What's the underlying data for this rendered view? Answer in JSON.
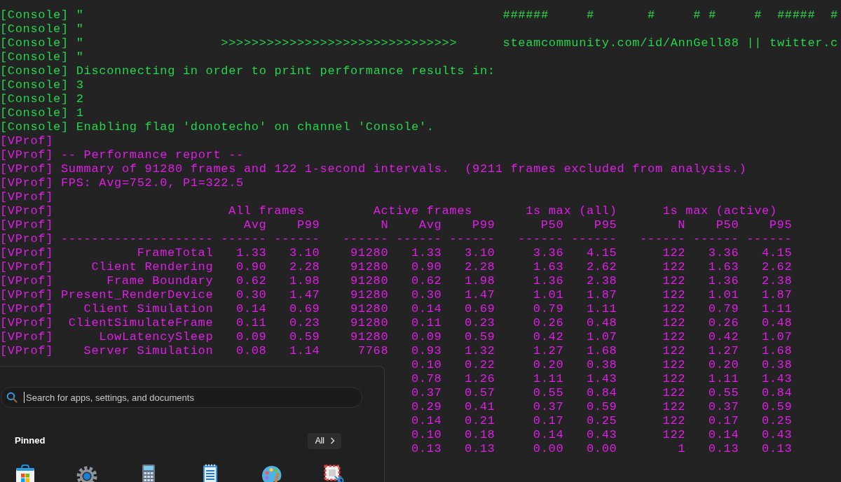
{
  "console": {
    "lines": [
      {
        "color": "#22d84a",
        "text": "[Console] \"                                                       ######     #       #     # #     #  #####  #"
      },
      {
        "color": "#22d84a",
        "text": "[Console] \""
      },
      {
        "color": "#22d84a",
        "text": "[Console] \"                  >>>>>>>>>>>>>>>>>>>>>>>>>>>>>>>      steamcommunity.com/id/AnnGell88 || twitter.c"
      },
      {
        "color": "#22d84a",
        "text": "[Console] \""
      },
      {
        "color": "#22d84a",
        "text": "[Console] Disconnecting in order to print performance results in:"
      },
      {
        "color": "#22d84a",
        "text": "[Console] 3"
      },
      {
        "color": "#22d84a",
        "text": "[Console] 2"
      },
      {
        "color": "#22d84a",
        "text": "[Console] 1"
      },
      {
        "color": "#22d84a",
        "text": "[Console] Enabling flag 'donotecho' on channel 'Console'."
      },
      {
        "color": "#e01ee8",
        "text": "[VProf]"
      },
      {
        "color": "#e01ee8",
        "text": "[VProf] -- Performance report --"
      },
      {
        "color": "#e01ee8",
        "text": "[VProf] Summary of 91280 frames and 122 1-second intervals.  (9211 frames excluded from analysis.)"
      },
      {
        "color": "#e01ee8",
        "text": "[VProf] FPS: Avg=752.0, P1=322.5"
      },
      {
        "color": "#e01ee8",
        "text": "[VProf]"
      }
    ]
  },
  "report_table": {
    "color": "#e01ee8",
    "groups": {
      "tag": "[VProf]",
      "labels": [
        "All frames",
        "Active frames",
        "1s max (all)",
        "1s max (active)"
      ]
    },
    "header": {
      "tag": "[VProf]",
      "cells": [
        "Avg",
        "P99",
        "N",
        "Avg",
        "P99",
        "P50",
        "P95",
        "N",
        "P50",
        "P95"
      ]
    },
    "rule": {
      "tag": "[VProf]",
      "cells": [
        "--------------------",
        "------",
        "------",
        "------",
        "------",
        "------",
        "------",
        "------",
        "------",
        "------",
        "------"
      ]
    },
    "rows": [
      {
        "tag": "[VProf]",
        "cells": [
          "FrameTotal",
          "1.33",
          "3.10",
          "91280",
          "1.33",
          "3.10",
          "3.36",
          "4.15",
          "122",
          "3.36",
          "4.15"
        ]
      },
      {
        "tag": "[VProf]",
        "cells": [
          "Client Rendering",
          "0.90",
          "2.28",
          "91280",
          "0.90",
          "2.28",
          "1.63",
          "2.62",
          "122",
          "1.63",
          "2.62"
        ]
      },
      {
        "tag": "[VProf]",
        "cells": [
          "Frame Boundary",
          "0.62",
          "1.98",
          "91280",
          "0.62",
          "1.98",
          "1.36",
          "2.38",
          "122",
          "1.36",
          "2.38"
        ]
      },
      {
        "tag": "[VProf]",
        "cells": [
          "Present_RenderDevice",
          "0.30",
          "1.47",
          "91280",
          "0.30",
          "1.47",
          "1.01",
          "1.87",
          "122",
          "1.01",
          "1.87"
        ]
      },
      {
        "tag": "[VProf]",
        "cells": [
          "Client Simulation",
          "0.14",
          "0.69",
          "91280",
          "0.14",
          "0.69",
          "0.79",
          "1.11",
          "122",
          "0.79",
          "1.11"
        ]
      },
      {
        "tag": "[VProf]",
        "cells": [
          "ClientSimulateFrame",
          "0.11",
          "0.23",
          "91280",
          "0.11",
          "0.23",
          "0.26",
          "0.48",
          "122",
          "0.26",
          "0.48"
        ]
      },
      {
        "tag": "[VProf]",
        "cells": [
          "LowLatencySleep",
          "0.09",
          "0.59",
          "91280",
          "0.09",
          "0.59",
          "0.42",
          "1.07",
          "122",
          "0.42",
          "1.07"
        ]
      },
      {
        "tag": "[VProf]",
        "cells": [
          "Server Simulation",
          "0.08",
          "1.14",
          "7768",
          "0.93",
          "1.32",
          "1.27",
          "1.68",
          "122",
          "1.27",
          "1.68"
        ]
      },
      {
        "cells": [
          "0.10",
          "0.22",
          "0.20",
          "0.38",
          "122",
          "0.20",
          "0.38"
        ]
      },
      {
        "cells": [
          "0.78",
          "1.26",
          "1.11",
          "1.43",
          "122",
          "1.11",
          "1.43"
        ]
      },
      {
        "cells": [
          "0.37",
          "0.57",
          "0.55",
          "0.84",
          "122",
          "0.55",
          "0.84"
        ]
      },
      {
        "cells": [
          "0.29",
          "0.41",
          "0.37",
          "0.59",
          "122",
          "0.37",
          "0.59"
        ]
      },
      {
        "cells": [
          "0.14",
          "0.21",
          "0.17",
          "0.25",
          "122",
          "0.17",
          "0.25"
        ]
      },
      {
        "cells": [
          "0.10",
          "0.18",
          "0.14",
          "0.43",
          "122",
          "0.14",
          "0.43"
        ]
      },
      {
        "cells": [
          "0.13",
          "0.13",
          "0.00",
          "0.00",
          "1",
          "0.13",
          "0.13"
        ]
      }
    ]
  },
  "start_menu": {
    "search": {
      "placeholder": "Search for apps, settings, and documents"
    },
    "pinned_label": "Pinned",
    "all_button": {
      "label": "All"
    },
    "pinned_apps": [
      {
        "kind": "store"
      },
      {
        "kind": "settings"
      },
      {
        "kind": "calculator"
      },
      {
        "kind": "notepad"
      },
      {
        "kind": "paint"
      },
      {
        "kind": "snipping"
      }
    ]
  }
}
